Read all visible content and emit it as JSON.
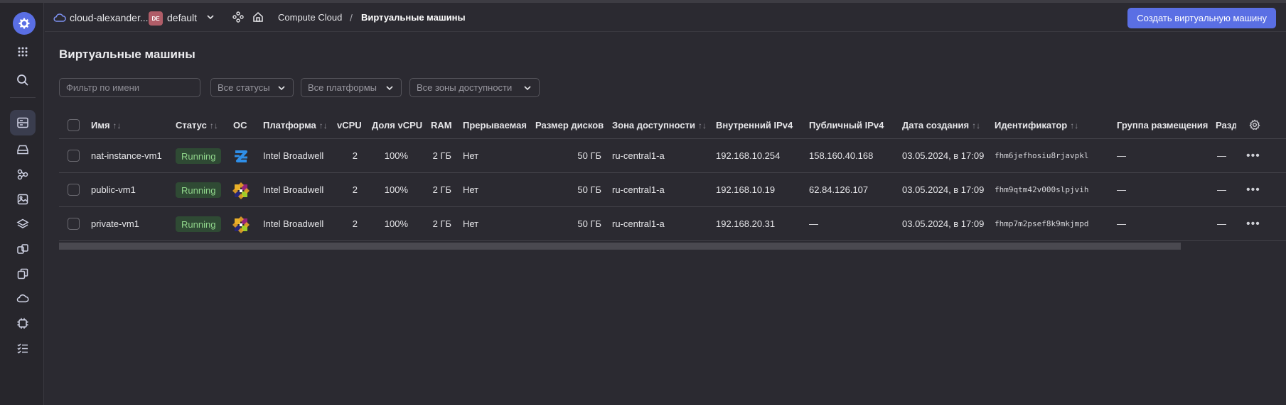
{
  "header": {
    "cloud_name": "cloud-alexander...",
    "folder_badge": "DE",
    "folder_name": "default",
    "breadcrumb_service": "Compute Cloud",
    "breadcrumb_separator": "/",
    "breadcrumb_current": "Виртуальные машины",
    "create_button": "Создать виртуальную машину"
  },
  "page": {
    "title": "Виртуальные машины"
  },
  "filters": {
    "name_placeholder": "Фильтр по имени",
    "status": "Все статусы",
    "platform": "Все платформы",
    "zone": "Все зоны доступности"
  },
  "table": {
    "columns": {
      "name": "Имя",
      "status": "Статус",
      "os": "ОС",
      "platform": "Платформа",
      "vcpu": "vCPU",
      "vcpu_share": "Доля vCPU",
      "ram": "RAM",
      "preemptible": "Прерываемая",
      "disk_size": "Размер дисков",
      "zone": "Зона доступности",
      "internal_ip": "Внутренний IPv4",
      "public_ip": "Публичный IPv4",
      "created": "Дата создания",
      "id": "Идентификатор",
      "placement_group": "Группа размещения",
      "partition": "Разде"
    },
    "rows": [
      {
        "name": "nat-instance-vm1",
        "status": "Running",
        "os": "ubuntu-icon",
        "platform": "Intel Broadwell",
        "vcpu": "2",
        "vcpu_share": "100%",
        "ram": "2 ГБ",
        "preemptible": "Нет",
        "disk_size": "50 ГБ",
        "zone": "ru-central1-a",
        "internal_ip": "192.168.10.254",
        "public_ip": "158.160.40.168",
        "created": "03.05.2024, в 17:09",
        "id": "fhm6jefhosiu8rjavpkl",
        "placement_group": "—",
        "partition": "—"
      },
      {
        "name": "public-vm1",
        "status": "Running",
        "os": "centos-icon",
        "platform": "Intel Broadwell",
        "vcpu": "2",
        "vcpu_share": "100%",
        "ram": "2 ГБ",
        "preemptible": "Нет",
        "disk_size": "50 ГБ",
        "zone": "ru-central1-a",
        "internal_ip": "192.168.10.19",
        "public_ip": "62.84.126.107",
        "created": "03.05.2024, в 17:09",
        "id": "fhm9qtm42v000slpjvih",
        "placement_group": "—",
        "partition": "—"
      },
      {
        "name": "private-vm1",
        "status": "Running",
        "os": "centos-icon",
        "platform": "Intel Broadwell",
        "vcpu": "2",
        "vcpu_share": "100%",
        "ram": "2 ГБ",
        "preemptible": "Нет",
        "disk_size": "50 ГБ",
        "zone": "ru-central1-a",
        "internal_ip": "192.168.20.31",
        "public_ip": "—",
        "created": "03.05.2024, в 17:09",
        "id": "fhmp7m2psef8k9mkjmpd",
        "placement_group": "—",
        "partition": "—"
      }
    ]
  },
  "colors": {
    "accent": "#5a6fe4",
    "status_running_bg": "#2f4a34",
    "status_running_text": "#8fd48a"
  }
}
